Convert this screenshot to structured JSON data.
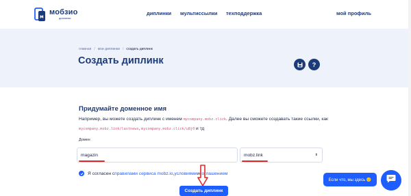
{
  "brand": {
    "name": "мобзио",
    "subtitle": "диплинки",
    "color": "#1c3a7a"
  },
  "nav": {
    "items": [
      "диплинки",
      "мультиссылки",
      "техподдержка"
    ],
    "profile": "мой профиль"
  },
  "breadcrumb": {
    "items": [
      "главная",
      "мои диплинки"
    ],
    "current": "создать диплинк",
    "separator": "/"
  },
  "page_title": "Создать диплинк",
  "hero_buttons": [
    {
      "icon": "save-icon"
    },
    {
      "icon": "help-icon",
      "glyph": "?"
    }
  ],
  "section": {
    "title": "Придумайте доменное имя",
    "desc_1": "Например, вы можете создать диплинк с именем ",
    "code_1": "mycompany.mobz.click",
    "desc_2": ". Далее вы сможете создавать такие ссылки, как ",
    "code_2": "mycompany.mobz.link/lastnews",
    "desc_3": ", ",
    "code_3": "mycompany.mobz.click/u8j0",
    "desc_4": " и тд"
  },
  "domain": {
    "label": "Домен",
    "name_value": "magazin",
    "zone_value": "mobz.link",
    "zone_arrow": "⬍"
  },
  "agreement": {
    "text": "Я согласен с ",
    "link_1": "правилами сервиса mobz.io",
    "text_2": ", ",
    "link_2": "условиями",
    "text_3": " и ",
    "link_3": "соглашением"
  },
  "create_button": "Создать диплинк",
  "chat": {
    "bubble": "Если что, мы здесь 🙂"
  },
  "colors": {
    "accent": "#1e5eff",
    "hero_bg": "#eef2fa",
    "highlight": "#e02828",
    "code": "#e0517a"
  }
}
